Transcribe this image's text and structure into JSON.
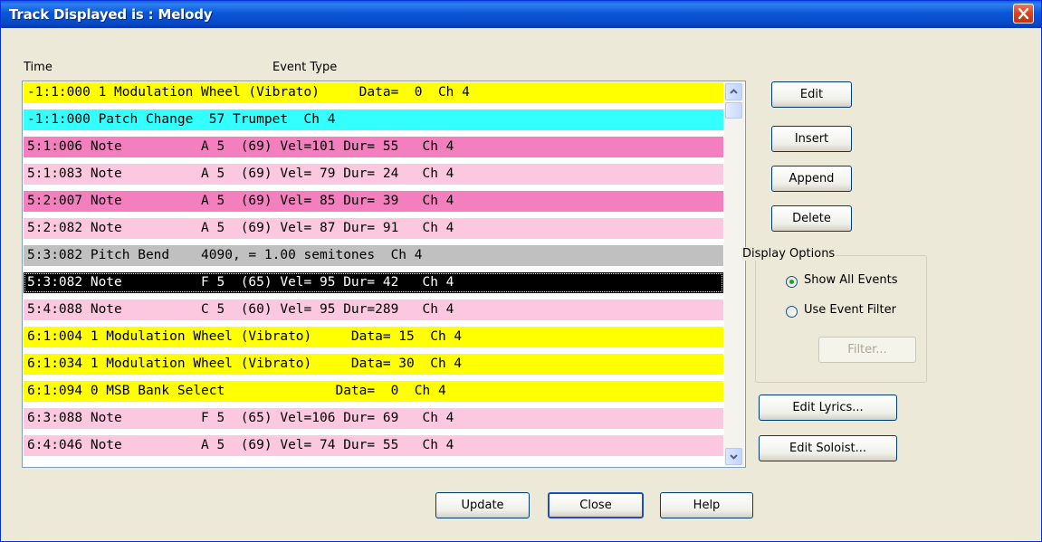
{
  "window": {
    "title": "Track Displayed is : Melody"
  },
  "columns": {
    "time": "Time",
    "event_type": "Event Type"
  },
  "colors": {
    "controller": "#ffff00",
    "patch": "#33ffff",
    "note_dark": "#f47fbf",
    "note_light": "#fcc8e0",
    "pitch_bend": "#c0c0c0",
    "selected": "#000000"
  },
  "events": [
    {
      "text": "-1:1:000 1 Modulation Wheel (Vibrato)     Data=  0  Ch 4",
      "kind": "controller"
    },
    {
      "text": "-1:1:000 Patch Change  57 Trumpet  Ch 4",
      "kind": "patch"
    },
    {
      "text": "5:1:006 Note          A 5  (69) Vel=101 Dur= 55   Ch 4",
      "kind": "note_dark"
    },
    {
      "text": "5:1:083 Note          A 5  (69) Vel= 79 Dur= 24   Ch 4",
      "kind": "note_light"
    },
    {
      "text": "5:2:007 Note          A 5  (69) Vel= 85 Dur= 39   Ch 4",
      "kind": "note_dark"
    },
    {
      "text": "5:2:082 Note          A 5  (69) Vel= 87 Dur= 91   Ch 4",
      "kind": "note_light"
    },
    {
      "text": "5:3:082 Pitch Bend    4090, = 1.00 semitones  Ch 4",
      "kind": "pitch_bend"
    },
    {
      "text": "5:3:082 Note          F 5  (65) Vel= 95 Dur= 42   Ch 4",
      "kind": "selected"
    },
    {
      "text": "5:4:088 Note          C 5  (60) Vel= 95 Dur=289   Ch 4",
      "kind": "note_light"
    },
    {
      "text": "6:1:004 1 Modulation Wheel (Vibrato)     Data= 15  Ch 4",
      "kind": "controller"
    },
    {
      "text": "6:1:034 1 Modulation Wheel (Vibrato)     Data= 30  Ch 4",
      "kind": "controller"
    },
    {
      "text": "6:1:094 0 MSB Bank Select              Data=  0  Ch 4",
      "kind": "controller"
    },
    {
      "text": "6:3:088 Note          F 5  (65) Vel=106 Dur= 69   Ch 4",
      "kind": "note_light"
    },
    {
      "text": "6:4:046 Note          A 5  (69) Vel= 74 Dur= 55   Ch 4",
      "kind": "note_light"
    }
  ],
  "buttons": {
    "edit": "Edit",
    "insert": "Insert",
    "append": "Append",
    "delete": "Delete",
    "edit_lyrics": "Edit Lyrics...",
    "edit_soloist": "Edit Soloist...",
    "update": "Update",
    "close": "Close",
    "help": "Help"
  },
  "display_options": {
    "title": "Display Options",
    "show_all_events": "Show All Events",
    "use_event_filter": "Use Event Filter",
    "selected": "show_all_events",
    "filter_button": "Filter..."
  }
}
